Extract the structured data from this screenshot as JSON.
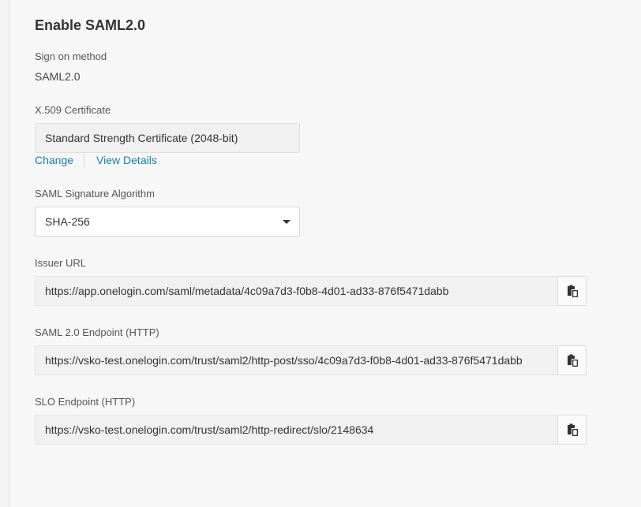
{
  "section": {
    "title": "Enable SAML2.0"
  },
  "sign_on": {
    "label": "Sign on method",
    "value": "SAML2.0"
  },
  "certificate": {
    "label": "X.509 Certificate",
    "value": "Standard Strength Certificate (2048-bit)",
    "change_link": "Change",
    "details_link": "View Details"
  },
  "signature": {
    "label": "SAML Signature Algorithm",
    "selected": "SHA-256"
  },
  "issuer": {
    "label": "Issuer URL",
    "value": "https://app.onelogin.com/saml/metadata/4c09a7d3-f0b8-4d01-ad33-876f5471dabb",
    "copy_icon": "clipboard-icon"
  },
  "saml_endpoint": {
    "label": "SAML 2.0 Endpoint (HTTP)",
    "value": "https://vsko-test.onelogin.com/trust/saml2/http-post/sso/4c09a7d3-f0b8-4d01-ad33-876f5471dabb",
    "copy_icon": "clipboard-icon"
  },
  "slo_endpoint": {
    "label": "SLO Endpoint (HTTP)",
    "value": "https://vsko-test.onelogin.com/trust/saml2/http-redirect/slo/2148634",
    "copy_icon": "clipboard-icon"
  },
  "colors": {
    "link": "#1a7fa8",
    "background": "#f7f7f7",
    "field_bg": "#f1f1f1"
  }
}
